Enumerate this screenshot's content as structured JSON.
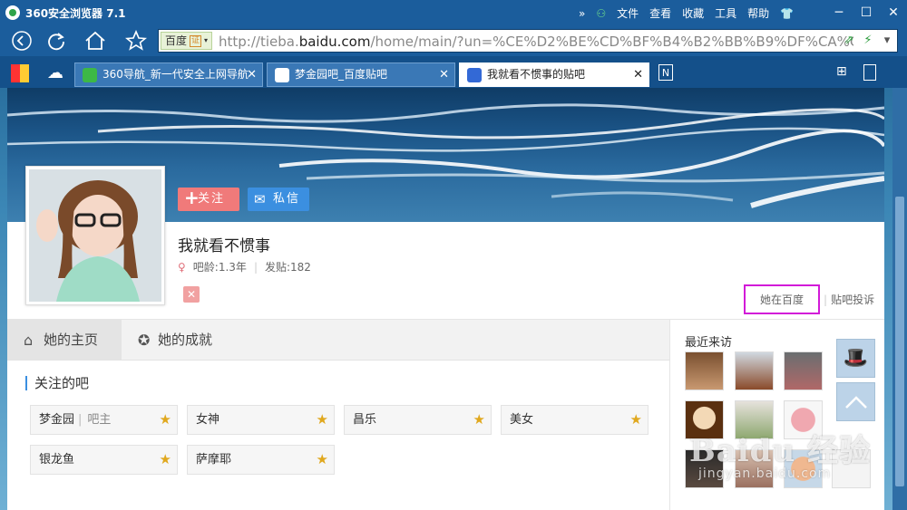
{
  "browser": {
    "app_title": "360安全浏览器 7.1",
    "menu": [
      "文件",
      "查看",
      "收藏",
      "工具",
      "帮助"
    ],
    "search_engine": "百度",
    "cert_badge": "证",
    "url_prefix": "http://tieba.",
    "url_domain": "baidu.com",
    "url_rest": "/home/main/?un=%CE%D2%BE%CD%BF%B4%B2%BB%B9%DF%CA%C28",
    "tabs": [
      {
        "label": "360导航_新一代安全上网导航",
        "color": "#3db846"
      },
      {
        "label": "梦金园吧_百度贴吧",
        "color": "#3369d6"
      },
      {
        "label": "我就看不惯事的贴吧",
        "color": "#3369d6"
      }
    ]
  },
  "profile": {
    "follow_label": "关注",
    "message_label": "私信",
    "username": "我就看不惯事",
    "age_label": "吧龄:1.3年",
    "posts_label": "发贴:182",
    "link_her_baidu": "她在百度",
    "link_report": "贴吧投诉"
  },
  "main": {
    "tabs": [
      {
        "label": "她的主页",
        "icon": "home-icon"
      },
      {
        "label": "她的成就",
        "icon": "award-icon"
      }
    ],
    "section_title": "关注的吧",
    "bars": [
      {
        "name": "梦金园",
        "role": "吧主"
      },
      {
        "name": "女神",
        "role": ""
      },
      {
        "name": "昌乐",
        "role": ""
      },
      {
        "name": "美女",
        "role": ""
      },
      {
        "name": "银龙鱼",
        "role": ""
      },
      {
        "name": "萨摩耶",
        "role": ""
      }
    ]
  },
  "sidebar": {
    "title": "最近来访"
  },
  "watermark": {
    "main": "Baidu 经验",
    "sub": "jingyan.baidu.com"
  }
}
